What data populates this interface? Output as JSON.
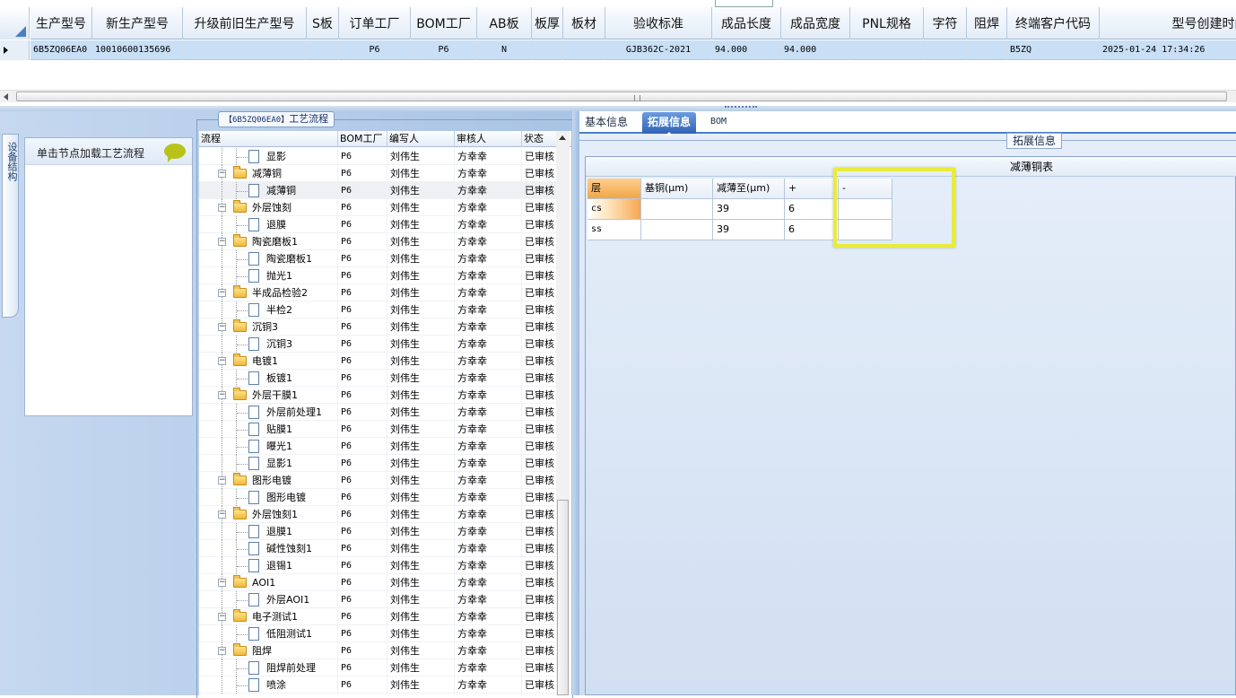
{
  "top_grid": {
    "columns": [
      "生产型号",
      "新生产型号",
      "升级前旧生产型号",
      "S板",
      "订单工厂",
      "BOM工厂",
      "AB板",
      "板厚",
      "板材",
      "验收标准",
      "成品长度",
      "成品宽度",
      "PNL规格",
      "字符",
      "阻焊",
      "终端客户代码",
      "型号创建时间"
    ],
    "row": [
      "6B5ZQ06EA0",
      "10010600135696",
      "",
      "",
      "P6",
      "P6",
      "N",
      "",
      "",
      "GJB362C-2021",
      "94.000",
      "94.000",
      "",
      "",
      "",
      "B5ZQ",
      "2025-01-24 17:34:26"
    ]
  },
  "left": {
    "vertical_tab": "设备结构",
    "node_hint": "单击节点加载工艺流程",
    "group_title_code": "【6B5ZQ06EA0】",
    "group_title_text": "工艺流程",
    "flow_columns": [
      "流程",
      "BOM工厂",
      "编写人",
      "审核人",
      "状态"
    ],
    "flow_rows": [
      {
        "name": "显影",
        "level": 1,
        "bom": "P6",
        "writer": "刘伟生",
        "reviewer": "方幸幸",
        "status": "已审核"
      },
      {
        "name": "减薄铜",
        "level": 0,
        "bom": "P6",
        "writer": "刘伟生",
        "reviewer": "方幸幸",
        "status": "已审核"
      },
      {
        "name": "减薄铜",
        "level": 1,
        "bom": "P6",
        "writer": "刘伟生",
        "reviewer": "方幸幸",
        "status": "已审核",
        "selected": true
      },
      {
        "name": "外层蚀刻",
        "level": 0,
        "bom": "P6",
        "writer": "刘伟生",
        "reviewer": "方幸幸",
        "status": "已审核"
      },
      {
        "name": "退膜",
        "level": 1,
        "bom": "P6",
        "writer": "刘伟生",
        "reviewer": "方幸幸",
        "status": "已审核"
      },
      {
        "name": "陶瓷磨板1",
        "level": 0,
        "bom": "P6",
        "writer": "刘伟生",
        "reviewer": "方幸幸",
        "status": "已审核"
      },
      {
        "name": "陶瓷磨板1",
        "level": 1,
        "bom": "P6",
        "writer": "刘伟生",
        "reviewer": "方幸幸",
        "status": "已审核"
      },
      {
        "name": "抛光1",
        "level": 1,
        "bom": "P6",
        "writer": "刘伟生",
        "reviewer": "方幸幸",
        "status": "已审核"
      },
      {
        "name": "半成品检验2",
        "level": 0,
        "bom": "P6",
        "writer": "刘伟生",
        "reviewer": "方幸幸",
        "status": "已审核"
      },
      {
        "name": "半检2",
        "level": 1,
        "bom": "P6",
        "writer": "刘伟生",
        "reviewer": "方幸幸",
        "status": "已审核"
      },
      {
        "name": "沉铜3",
        "level": 0,
        "bom": "P6",
        "writer": "刘伟生",
        "reviewer": "方幸幸",
        "status": "已审核"
      },
      {
        "name": "沉铜3",
        "level": 1,
        "bom": "P6",
        "writer": "刘伟生",
        "reviewer": "方幸幸",
        "status": "已审核"
      },
      {
        "name": "电镀1",
        "level": 0,
        "bom": "P6",
        "writer": "刘伟生",
        "reviewer": "方幸幸",
        "status": "已审核"
      },
      {
        "name": "板镀1",
        "level": 1,
        "bom": "P6",
        "writer": "刘伟生",
        "reviewer": "方幸幸",
        "status": "已审核"
      },
      {
        "name": "外层干膜1",
        "level": 0,
        "bom": "P6",
        "writer": "刘伟生",
        "reviewer": "方幸幸",
        "status": "已审核"
      },
      {
        "name": "外层前处理1",
        "level": 1,
        "bom": "P6",
        "writer": "刘伟生",
        "reviewer": "方幸幸",
        "status": "已审核"
      },
      {
        "name": "贴膜1",
        "level": 1,
        "bom": "P6",
        "writer": "刘伟生",
        "reviewer": "方幸幸",
        "status": "已审核"
      },
      {
        "name": "曝光1",
        "level": 1,
        "bom": "P6",
        "writer": "刘伟生",
        "reviewer": "方幸幸",
        "status": "已审核"
      },
      {
        "name": "显影1",
        "level": 1,
        "bom": "P6",
        "writer": "刘伟生",
        "reviewer": "方幸幸",
        "status": "已审核"
      },
      {
        "name": "图形电镀",
        "level": 0,
        "bom": "P6",
        "writer": "刘伟生",
        "reviewer": "方幸幸",
        "status": "已审核"
      },
      {
        "name": "图形电镀",
        "level": 1,
        "bom": "P6",
        "writer": "刘伟生",
        "reviewer": "方幸幸",
        "status": "已审核"
      },
      {
        "name": "外层蚀刻1",
        "level": 0,
        "bom": "P6",
        "writer": "刘伟生",
        "reviewer": "方幸幸",
        "status": "已审核"
      },
      {
        "name": "退膜1",
        "level": 1,
        "bom": "P6",
        "writer": "刘伟生",
        "reviewer": "方幸幸",
        "status": "已审核"
      },
      {
        "name": "碱性蚀刻1",
        "level": 1,
        "bom": "P6",
        "writer": "刘伟生",
        "reviewer": "方幸幸",
        "status": "已审核"
      },
      {
        "name": "退锡1",
        "level": 1,
        "bom": "P6",
        "writer": "刘伟生",
        "reviewer": "方幸幸",
        "status": "已审核"
      },
      {
        "name": "AOI1",
        "level": 0,
        "bom": "P6",
        "writer": "刘伟生",
        "reviewer": "方幸幸",
        "status": "已审核"
      },
      {
        "name": "外层AOI1",
        "level": 1,
        "bom": "P6",
        "writer": "刘伟生",
        "reviewer": "方幸幸",
        "status": "已审核"
      },
      {
        "name": "电子测试1",
        "level": 0,
        "bom": "P6",
        "writer": "刘伟生",
        "reviewer": "方幸幸",
        "status": "已审核"
      },
      {
        "name": "低阻测试1",
        "level": 1,
        "bom": "P6",
        "writer": "刘伟生",
        "reviewer": "方幸幸",
        "status": "已审核"
      },
      {
        "name": "阻焊",
        "level": 0,
        "bom": "P6",
        "writer": "刘伟生",
        "reviewer": "方幸幸",
        "status": "已审核"
      },
      {
        "name": "阻焊前处理",
        "level": 1,
        "bom": "P6",
        "writer": "刘伟生",
        "reviewer": "方幸幸",
        "status": "已审核"
      },
      {
        "name": "喷涂",
        "level": 1,
        "bom": "P6",
        "writer": "刘伟生",
        "reviewer": "方幸幸",
        "status": "已审核"
      }
    ]
  },
  "right": {
    "tabs": [
      "基本信息",
      "拓展信息",
      "BOM"
    ],
    "active_tab": "拓展信息",
    "section_label": "拓展信息",
    "table_caption": "减薄铜表",
    "table_columns": [
      "层",
      "基铜(μm)",
      "减薄至(μm)",
      "+",
      "-"
    ],
    "table_rows": [
      [
        "cs",
        "",
        "39",
        "6",
        ""
      ],
      [
        "ss",
        "",
        "39",
        "6",
        ""
      ]
    ]
  },
  "colors": {
    "accent": "#2f63b5",
    "selection": "#c9dff6",
    "highlight_box": "#e8ec3a"
  }
}
